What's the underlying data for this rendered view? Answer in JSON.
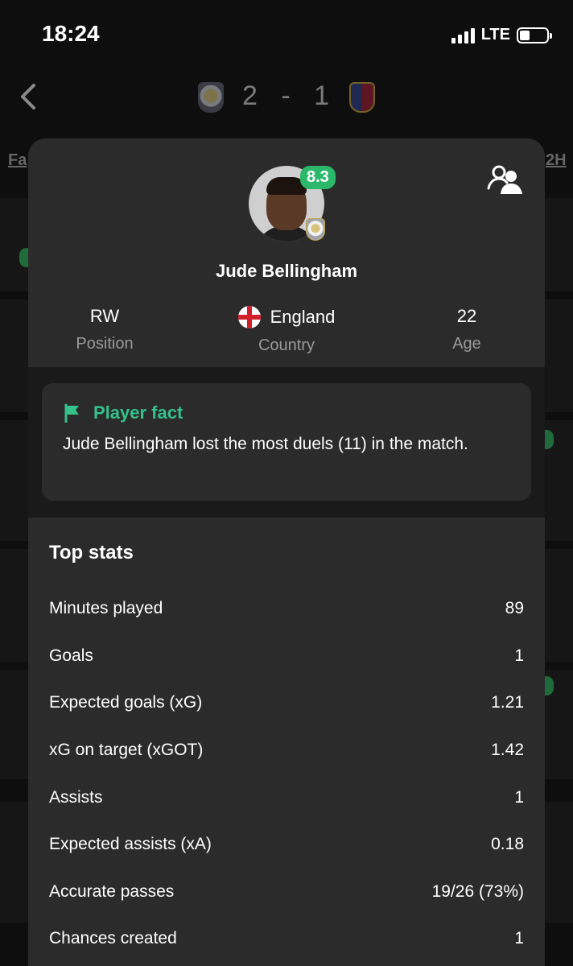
{
  "status": {
    "time": "18:24",
    "network": "LTE"
  },
  "match": {
    "home_score": "2",
    "separator": "-",
    "away_score": "1"
  },
  "background_tabs": {
    "left_partial": "Fa",
    "right_partial": "2H"
  },
  "player": {
    "name": "Jude Bellingham",
    "rating": "8.3",
    "position_value": "RW",
    "position_label": "Position",
    "country_value": "England",
    "country_label": "Country",
    "age_value": "22",
    "age_label": "Age"
  },
  "fact": {
    "title": "Player fact",
    "text": "Jude Bellingham lost the most duels (11) in the match."
  },
  "top_stats": {
    "title": "Top stats",
    "rows": [
      {
        "label": "Minutes played",
        "value": "89"
      },
      {
        "label": "Goals",
        "value": "1"
      },
      {
        "label": "Expected goals (xG)",
        "value": "1.21"
      },
      {
        "label": "xG on target (xGOT)",
        "value": "1.42"
      },
      {
        "label": "Assists",
        "value": "1"
      },
      {
        "label": "Expected assists (xA)",
        "value": "0.18"
      },
      {
        "label": "Accurate passes",
        "value": "19/26 (73%)"
      },
      {
        "label": "Chances created",
        "value": "1"
      }
    ]
  },
  "colors": {
    "accent_green": "#2bb86a",
    "fact_green": "#35c18a",
    "card_bg": "#2b2b2b"
  },
  "icons": [
    "back-icon",
    "people-icon",
    "flag-icon",
    "england-flag-icon",
    "real-madrid-crest",
    "barcelona-crest"
  ]
}
